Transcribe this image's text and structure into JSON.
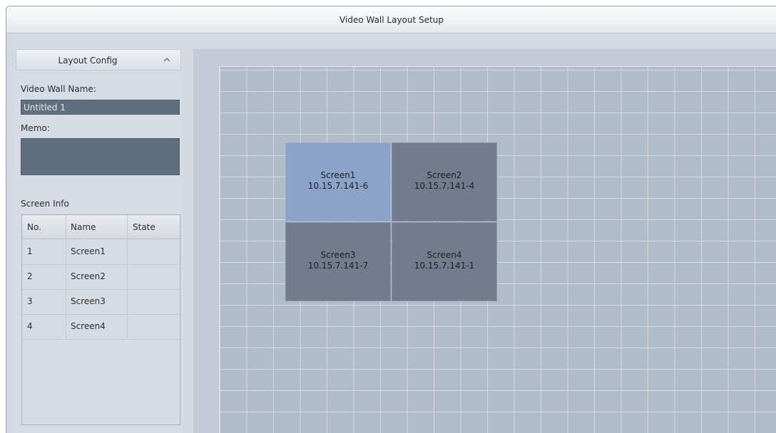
{
  "window": {
    "title": "Video Wall Layout Setup"
  },
  "layout_config": {
    "header": "Layout Config",
    "collapse_icon": "chevron-up-icon",
    "name_label": "Video Wall Name:",
    "name_value": "Untitled 1",
    "memo_label": "Memo:",
    "memo_value": ""
  },
  "screen_info": {
    "label": "Screen Info",
    "columns": [
      "No.",
      "Name",
      "State"
    ],
    "rows": [
      {
        "no": "1",
        "name": "Screen1",
        "state": ""
      },
      {
        "no": "2",
        "name": "Screen2",
        "state": ""
      },
      {
        "no": "3",
        "name": "Screen3",
        "state": ""
      },
      {
        "no": "4",
        "name": "Screen4",
        "state": ""
      }
    ]
  },
  "wall": {
    "screens": [
      {
        "name": "Screen1",
        "ip": "10.15.7.141-6",
        "selected": true
      },
      {
        "name": "Screen2",
        "ip": "10.15.7.141-4",
        "selected": false
      },
      {
        "name": "Screen3",
        "ip": "10.15.7.141-7",
        "selected": false
      },
      {
        "name": "Screen4",
        "ip": "10.15.7.141-1",
        "selected": false
      }
    ],
    "colors": {
      "selected": "#8aa3c7",
      "normal": "#727c8c",
      "grid": "#b1bccb"
    }
  }
}
